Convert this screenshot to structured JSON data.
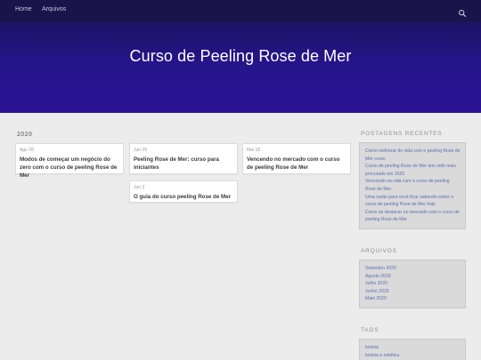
{
  "nav": {
    "home": "Home",
    "archives": "Arquivos"
  },
  "site": {
    "title": "Curso de Peeling Rose de Mer"
  },
  "archive": {
    "year": "2020",
    "posts": [
      {
        "date": "Ago 28",
        "title": "Modos de começar um negócio do zero com o curso de peeling Rose de Mer"
      },
      {
        "date": "Jun 29",
        "title": "Peeling Rose de Mer: curso para iniciantes"
      },
      {
        "date": "Mai 18",
        "title": "Vencendo no mercado com o curso de peeling Rose de Mer"
      },
      {
        "date": "Jun 3",
        "title": "O guia do curso peeling Rose de Mer"
      }
    ]
  },
  "sidebar": {
    "recent_heading": "POSTAGENS RECENTES",
    "recent": [
      "Como melhorar de vida com o peeling Rose de Mer curso",
      "Curso de peeling Rose de Mer tem sido mais procurado em 2020",
      "Vencendo na vida com o curso de peeling Rose de Mer",
      "Uma razão para você ficar sabendo sobre o curso de peeling Rose de Mer hoje",
      "Como se destacar no mercado com o curso de peeling Rose de Mer"
    ],
    "archives_heading": "ARQUIVOS",
    "archives": [
      "Setembro 2020",
      "Agosto 2020",
      "Julho 2020",
      "Junho 2020",
      "Maio 2020"
    ],
    "tags_heading": "TAGS",
    "tags": [
      "beleza",
      "beleza e estética"
    ]
  },
  "icons": {
    "search": "search-icon"
  },
  "colors": {
    "header_bg": "#2a1494",
    "nav_bg": "#191449",
    "link": "#5b6fb3"
  }
}
